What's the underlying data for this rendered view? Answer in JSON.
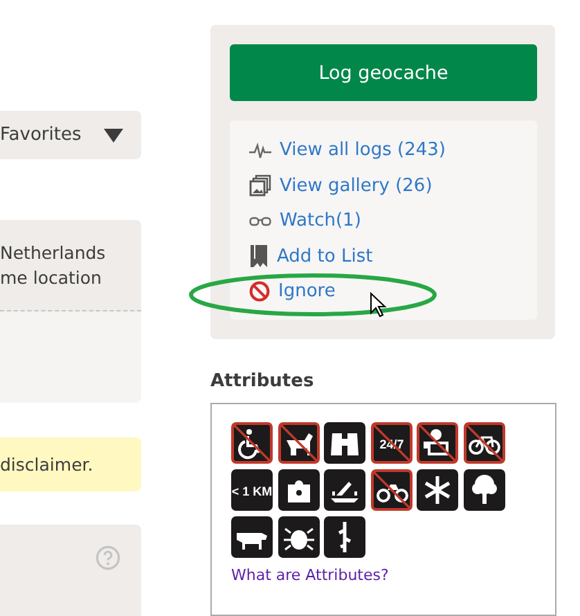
{
  "left_panels": {
    "favorites_dropdown": {
      "label": "Favorites"
    },
    "location": {
      "lines": [
        "Netherlands",
        "me location"
      ]
    },
    "notice": {
      "text": "disclaimer."
    }
  },
  "sidebar": {
    "log_button": "Log geocache",
    "links": [
      {
        "kind": "logs",
        "label": "View all logs (243)"
      },
      {
        "kind": "gallery",
        "label": "View gallery (26)"
      },
      {
        "kind": "watch",
        "label": "Watch(1)"
      },
      {
        "kind": "list",
        "label": "Add to List"
      },
      {
        "kind": "ignore",
        "label": "Ignore"
      }
    ]
  },
  "attributes": {
    "title": "Attributes",
    "items": [
      {
        "kind": "wheelchair",
        "negated": true
      },
      {
        "kind": "dog",
        "negated": true
      },
      {
        "kind": "binoculars",
        "negated": false
      },
      {
        "kind": "text",
        "label": "24/7",
        "negated": true
      },
      {
        "kind": "parking",
        "negated": true
      },
      {
        "kind": "bicycle",
        "negated": true
      },
      {
        "kind": "text",
        "label": "< 1 KM",
        "negated": false
      },
      {
        "kind": "puzzle",
        "negated": false
      },
      {
        "kind": "boat",
        "negated": false
      },
      {
        "kind": "motorcycle",
        "negated": true
      },
      {
        "kind": "snowflake",
        "negated": false
      },
      {
        "kind": "tree",
        "negated": false
      },
      {
        "kind": "cow",
        "negated": false
      },
      {
        "kind": "tick",
        "negated": false
      },
      {
        "kind": "thorn",
        "negated": false
      }
    ],
    "link": "What are Attributes?"
  }
}
